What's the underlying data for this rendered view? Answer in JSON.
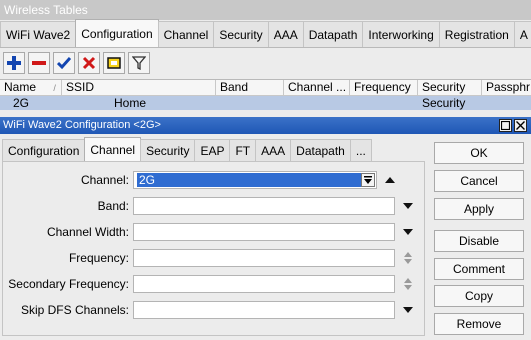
{
  "background_window": {
    "title": "Wireless Tables",
    "tabs": [
      "WiFi Wave2",
      "Configuration",
      "Channel",
      "Security",
      "AAA",
      "Datapath",
      "Interworking",
      "Registration",
      "A"
    ],
    "active_tab_index": 1,
    "toolbar": [
      "add-icon",
      "remove-icon",
      "enable-icon",
      "disable-icon",
      "comment-icon",
      "filter-icon"
    ],
    "table": {
      "columns": [
        "Name",
        "SSID",
        "Band",
        "Channel ...",
        "Frequency",
        "Security",
        "Passphr"
      ],
      "rows": [
        {
          "name": "2G",
          "ssid": "Home",
          "band": "",
          "channel": "",
          "frequency": "",
          "security": "Security",
          "passphrase": ""
        }
      ]
    }
  },
  "dialog": {
    "title": "WiFi Wave2 Configuration <2G>",
    "tabs": [
      "Configuration",
      "Channel",
      "Security",
      "EAP",
      "FT",
      "AAA",
      "Datapath",
      "..."
    ],
    "active_tab_index": 1,
    "fields": [
      {
        "label": "Channel:",
        "value": "2G",
        "control": "dropdown-with-collapse"
      },
      {
        "label": "Band:",
        "value": "",
        "control": "dropdown"
      },
      {
        "label": "Channel Width:",
        "value": "",
        "control": "dropdown"
      },
      {
        "label": "Frequency:",
        "value": "",
        "control": "spinner"
      },
      {
        "label": "Secondary Frequency:",
        "value": "",
        "control": "spinner"
      },
      {
        "label": "Skip DFS Channels:",
        "value": "",
        "control": "dropdown"
      }
    ],
    "buttons": [
      "OK",
      "Cancel",
      "Apply",
      "Disable",
      "Comment",
      "Copy",
      "Remove"
    ]
  },
  "colors": {
    "dialog_title_bg": "#1f57b5",
    "selection_bg": "#2f6cd1",
    "row_highlight": "#b8c9e4"
  }
}
